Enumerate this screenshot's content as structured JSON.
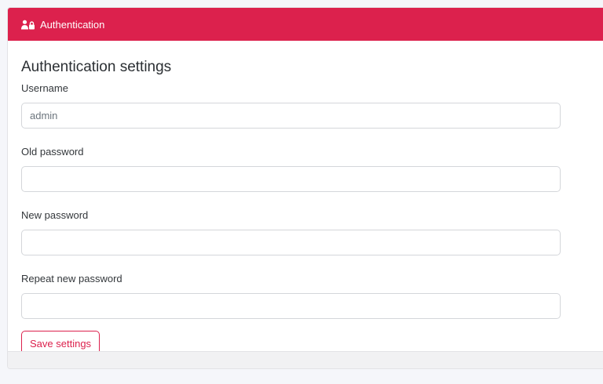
{
  "header": {
    "title": "Authentication",
    "icon": "users-lock-icon",
    "color": "#dc214d"
  },
  "main": {
    "title": "Authentication settings",
    "fields": [
      {
        "label": "Username",
        "value": "admin",
        "placeholder": ""
      },
      {
        "label": "Old password",
        "value": "",
        "placeholder": ""
      },
      {
        "label": "New password",
        "value": "",
        "placeholder": ""
      },
      {
        "label": "Repeat new password",
        "value": "",
        "placeholder": ""
      }
    ],
    "save_label": "Save settings"
  }
}
